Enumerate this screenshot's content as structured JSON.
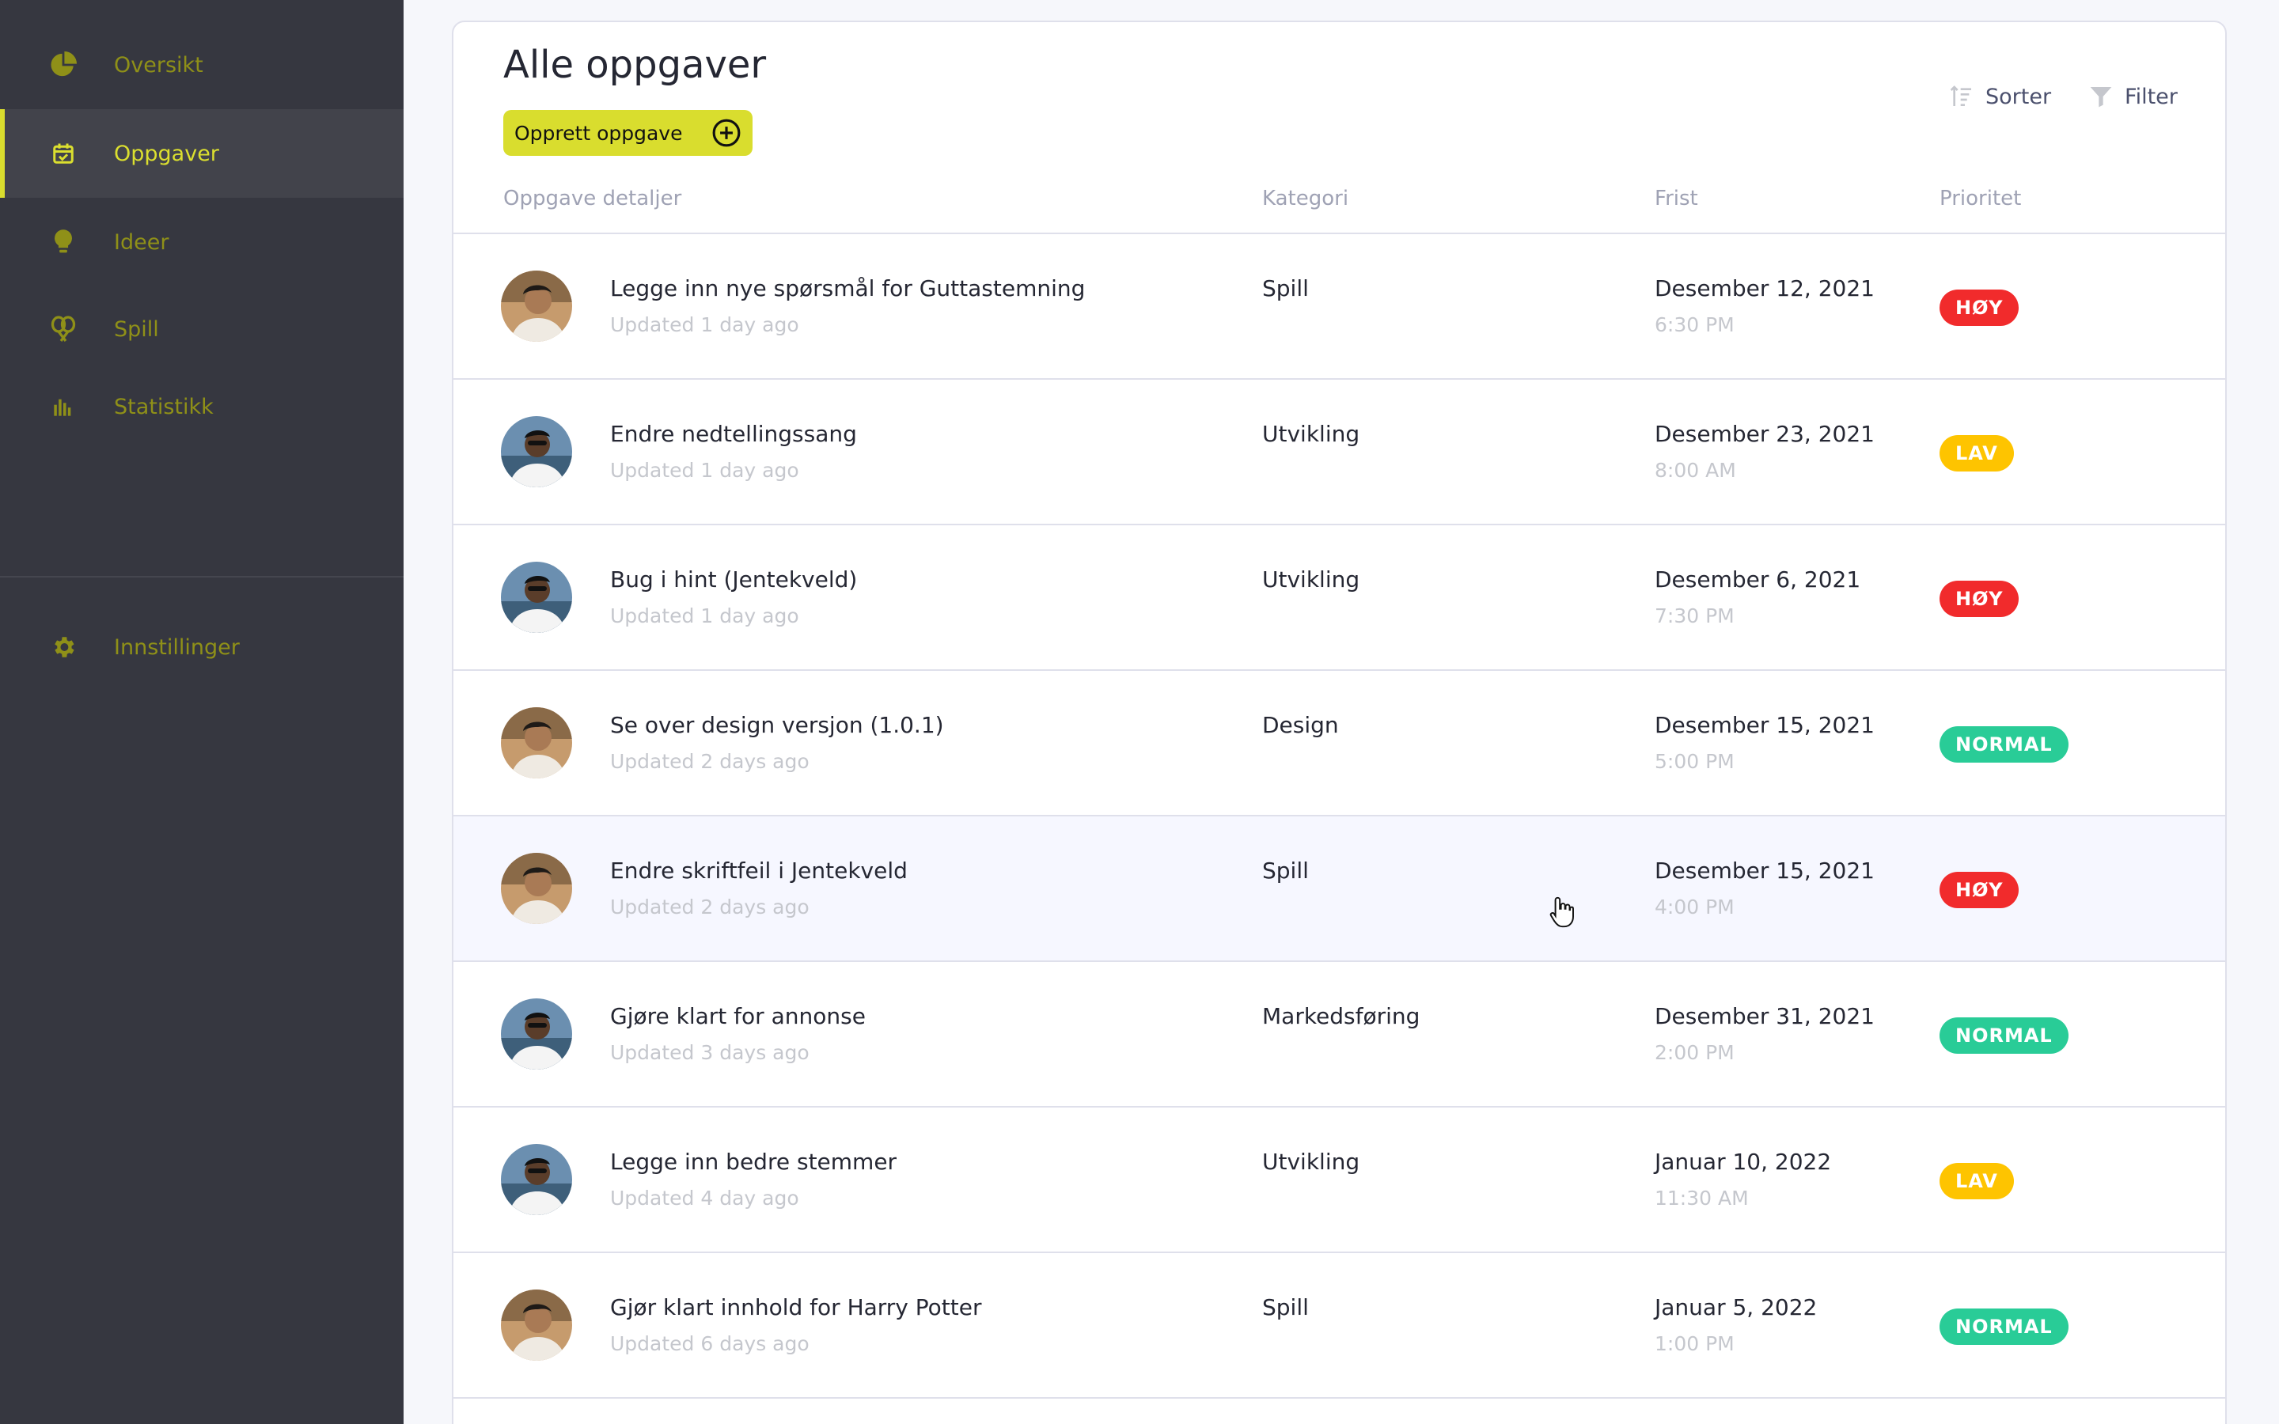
{
  "sidebar": {
    "items": [
      {
        "label": "Oversikt",
        "icon": "pie-chart-icon"
      },
      {
        "label": "Oppgaver",
        "icon": "calendar-check-icon",
        "active": true
      },
      {
        "label": "Ideer",
        "icon": "lightbulb-icon"
      },
      {
        "label": "Spill",
        "icon": "tennis-rackets-icon"
      },
      {
        "label": "Statistikk",
        "icon": "bar-chart-icon"
      }
    ],
    "settings": {
      "label": "Innstillinger",
      "icon": "gear-icon"
    }
  },
  "header": {
    "title": "Alle oppgaver",
    "create_label": "Opprett oppgave",
    "sort_label": "Sorter",
    "filter_label": "Filter"
  },
  "table": {
    "columns": [
      "Oppgave detaljer",
      "Kategori",
      "Frist",
      "Prioritet"
    ],
    "rows": [
      {
        "title": "Legge inn nye spørsmål for Guttastemning",
        "updated": "Updated 1 day ago",
        "category": "Spill",
        "date": "Desember 12, 2021",
        "time": "6:30 PM",
        "priority": "HØY",
        "level": "high",
        "avatar": "a"
      },
      {
        "title": "Endre nedtellingssang",
        "updated": "Updated 1 day ago",
        "category": "Utvikling",
        "date": "Desember 23, 2021",
        "time": "8:00 AM",
        "priority": "LAV",
        "level": "low",
        "avatar": "b"
      },
      {
        "title": "Bug i hint (Jentekveld)",
        "updated": "Updated 1 day ago",
        "category": "Utvikling",
        "date": "Desember 6, 2021",
        "time": "7:30 PM",
        "priority": "HØY",
        "level": "high",
        "avatar": "b"
      },
      {
        "title": "Se over design versjon (1.0.1)",
        "updated": "Updated 2 days ago",
        "category": "Design",
        "date": "Desember 15, 2021",
        "time": "5:00 PM",
        "priority": "NORMAL",
        "level": "normal",
        "avatar": "a"
      },
      {
        "title": "Endre skriftfeil i Jentekveld",
        "updated": "Updated 2 days ago",
        "category": "Spill",
        "date": "Desember 15, 2021",
        "time": "4:00 PM",
        "priority": "HØY",
        "level": "high",
        "avatar": "a",
        "hover": true
      },
      {
        "title": "Gjøre klart for annonse",
        "updated": "Updated 3 days ago",
        "category": "Markedsføring",
        "date": "Desember 31, 2021",
        "time": "2:00 PM",
        "priority": "NORMAL",
        "level": "normal",
        "avatar": "b"
      },
      {
        "title": "Legge inn bedre stemmer",
        "updated": "Updated 4 day ago",
        "category": "Utvikling",
        "date": "Januar 10, 2022",
        "time": "11:30 AM",
        "priority": "LAV",
        "level": "low",
        "avatar": "b"
      },
      {
        "title": "Gjør klart innhold for Harry Potter",
        "updated": "Updated 6 days ago",
        "category": "Spill",
        "date": "Januar 5, 2022",
        "time": "1:00 PM",
        "priority": "NORMAL",
        "level": "normal",
        "avatar": "a"
      }
    ]
  },
  "colors": {
    "sidebar_bg": "#363740",
    "accent": "#d9dd2e",
    "high": "#f12b2c",
    "low": "#fec400",
    "normal": "#29cc97"
  }
}
